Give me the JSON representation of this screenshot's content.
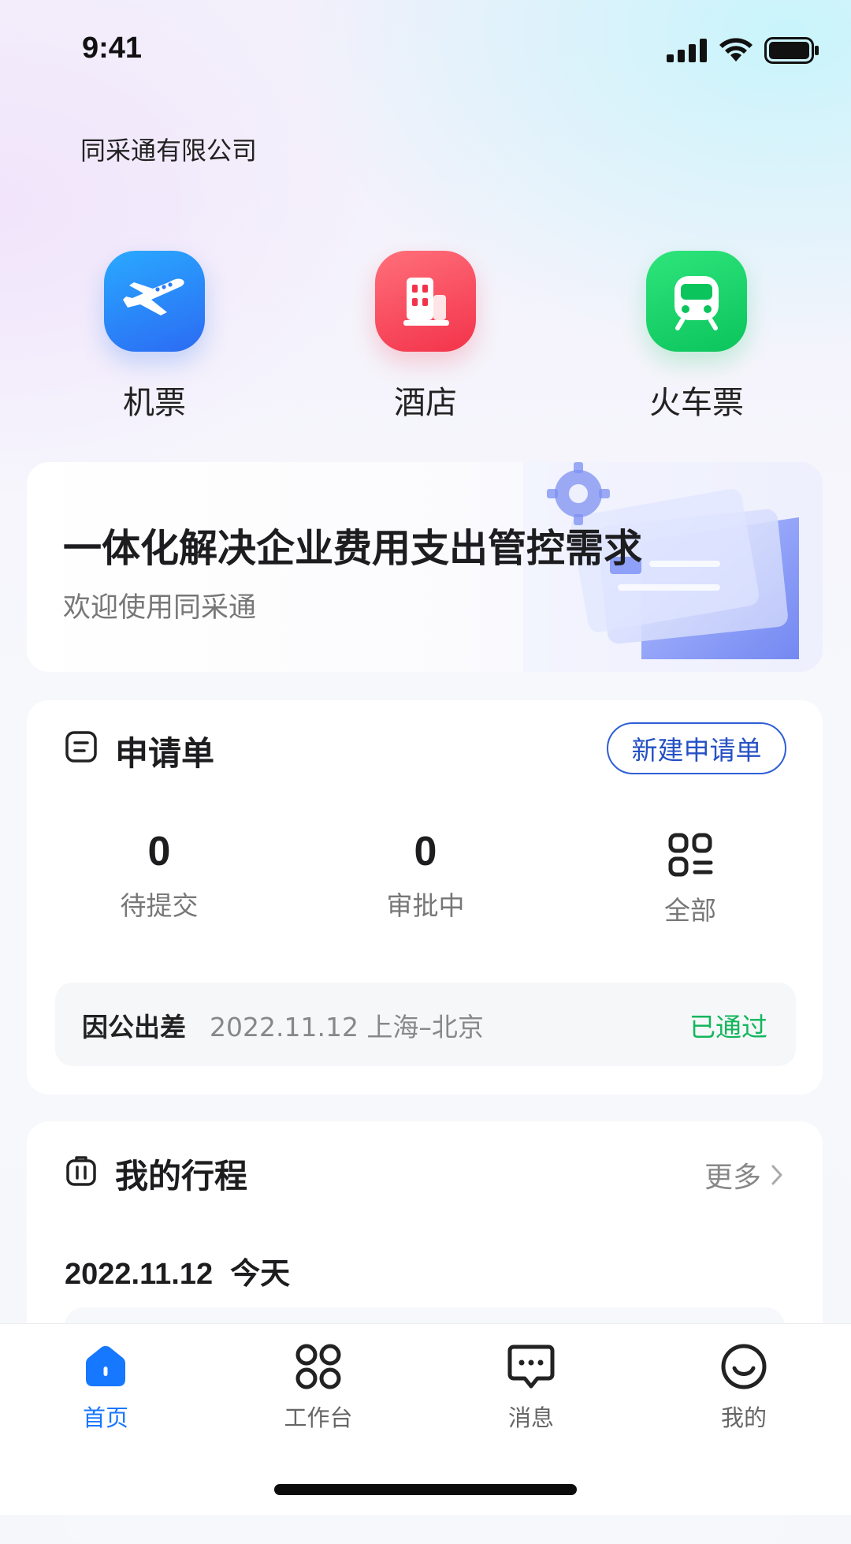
{
  "status_bar": {
    "time": "9:41"
  },
  "header": {
    "company": "同采通有限公司"
  },
  "quick_entries": [
    {
      "label": "机票",
      "icon": "airplane-icon",
      "color": "#2b7bf3"
    },
    {
      "label": "酒店",
      "icon": "hotel-building-icon",
      "color": "#f3334a"
    },
    {
      "label": "火车票",
      "icon": "train-icon",
      "color": "#0bc45b"
    }
  ],
  "banner": {
    "title": "一体化解决企业费用支出管控需求",
    "subtitle": "欢迎使用同采通"
  },
  "application": {
    "title": "申请单",
    "new_button": "新建申请单",
    "stats": [
      {
        "value": "0",
        "label": "待提交"
      },
      {
        "value": "0",
        "label": "审批中"
      }
    ],
    "all_label": "全部",
    "recent": {
      "type": "因公出差",
      "detail": "2022.11.12 上海–北京",
      "status": "已通过",
      "status_color": "#13b65d"
    }
  },
  "trips": {
    "title": "我的行程",
    "more": "更多",
    "date": "2022.11.12",
    "day": "今天"
  },
  "tabbar": {
    "items": [
      {
        "label": "首页",
        "icon": "home-icon",
        "active": true
      },
      {
        "label": "工作台",
        "icon": "grid-workbench-icon",
        "active": false
      },
      {
        "label": "消息",
        "icon": "message-icon",
        "active": false
      },
      {
        "label": "我的",
        "icon": "smile-profile-icon",
        "active": false
      }
    ],
    "active_color": "#1677ff"
  }
}
